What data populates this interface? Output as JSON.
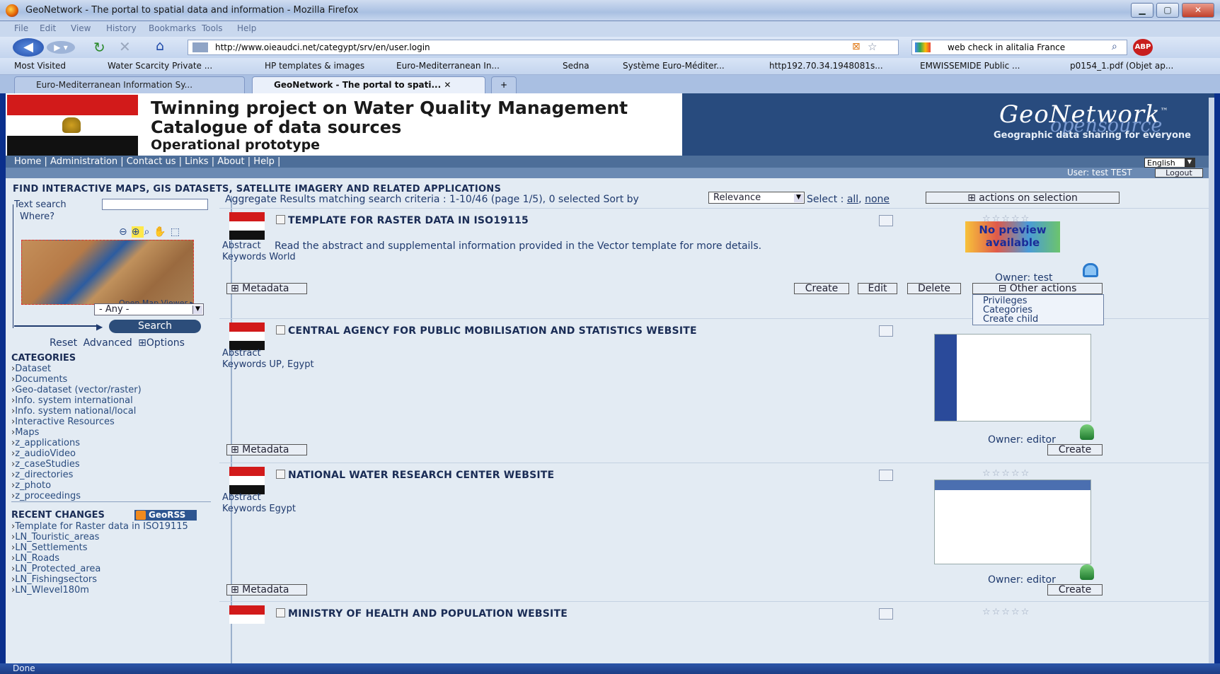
{
  "window": {
    "title": "GeoNetwork - The portal to spatial data and information - Mozilla Firefox"
  },
  "menu": [
    "File",
    "Edit",
    "View",
    "History",
    "Bookmarks",
    "Tools",
    "Help"
  ],
  "nav": {
    "url": "http://www.oieaudci.net/categypt/srv/en/user.login",
    "search_value": "web check in alitalia France"
  },
  "bookmarks": [
    "Most Visited",
    "Water Scarcity Private ...",
    "HP templates & images",
    "Euro-Mediterranean In...",
    "Sedna",
    "Système Euro-Méditer...",
    "http192.70.34.1948081s...",
    "EMWISSEMIDE Public ...",
    "p0154_1.pdf (Objet ap..."
  ],
  "tabs": [
    {
      "label": "Euro-Mediterranean Information Sy..."
    },
    {
      "label": "GeoNetwork - The portal to spati..."
    }
  ],
  "header": {
    "title1": "Twinning project on Water Quality Management",
    "title2": "Catalogue of data sources",
    "title3": "Operational prototype",
    "logo": "GeoNetwork",
    "logo_tm": "™",
    "logo_sub": "opensource",
    "tagline": "Geographic data sharing for everyone"
  },
  "topnav": {
    "links": "Home | Administration | Contact us | Links | About | Help |",
    "language": "English",
    "user": "User: test TEST",
    "logout": "Logout"
  },
  "find_heading": "FIND INTERACTIVE MAPS, GIS DATASETS, SATELLITE IMAGERY AND RELATED APPLICATIONS",
  "sidebar": {
    "text_search_label": "Text search",
    "where_label": "Where?",
    "open_map": "Open Map Viewer ▸",
    "region_value": "- Any -",
    "search_button": "Search",
    "reset": "Reset",
    "advanced": "Advanced",
    "options": "⊞Options",
    "categories_heading": "CATEGORIES",
    "categories": [
      "Dataset",
      "Documents",
      "Geo-dataset (vector/raster)",
      "Info. system international",
      "Info. system national/local",
      "Interactive Resources",
      "Maps",
      "z_applications",
      "z_audioVideo",
      "z_caseStudies",
      "z_directories",
      "z_photo",
      "z_proceedings"
    ],
    "recent_heading": "RECENT CHANGES",
    "georss": "GeoRSS",
    "recent": [
      "Template for Raster data in ISO19115",
      "LN_Touristic_areas",
      "LN_Settlements",
      "LN_Roads",
      "LN_Protected_area",
      "LN_Fishingsectors",
      "LN_Wlevel180m"
    ]
  },
  "results": {
    "aggregate": "Aggregate Results matching search criteria :  1-10/46  (page 1/5),  0 selected  Sort by",
    "sort_value": "Relevance",
    "select_label": "Select :",
    "select_all": "all",
    "select_none": "none",
    "actions_on_selection": "⊞ actions on selection",
    "metadata_btn": "⊞ Metadata",
    "abstract_label": "Abstract",
    "records": [
      {
        "title": "TEMPLATE FOR RASTER DATA IN ISO19115",
        "abstract": "Read the abstract and supplemental information provided in the Vector template for more details.",
        "keywords": "Keywords World",
        "owner": "Owner: test",
        "preview": "No preview available"
      },
      {
        "title": "CENTRAL AGENCY FOR PUBLIC MOBILISATION AND STATISTICS WEBSITE",
        "abstract": "",
        "keywords": "Keywords UP, Egypt",
        "owner": "Owner: editor"
      },
      {
        "title": "NATIONAL WATER RESEARCH CENTER WEBSITE",
        "abstract": "",
        "keywords": "Keywords Egypt",
        "owner": "Owner: editor"
      },
      {
        "title": "MINISTRY OF HEALTH AND POPULATION WEBSITE"
      }
    ],
    "buttons": {
      "create": "Create",
      "edit": "Edit",
      "delete": "Delete",
      "other_actions": "⊟ Other actions"
    },
    "other_actions_menu": [
      "Privileges",
      "Categories",
      "Create child"
    ]
  },
  "status": "Done",
  "colors": {
    "header_blue": "#284b7e",
    "page_bg": "#e3ebf3",
    "flag_red": "#d21a1a"
  }
}
